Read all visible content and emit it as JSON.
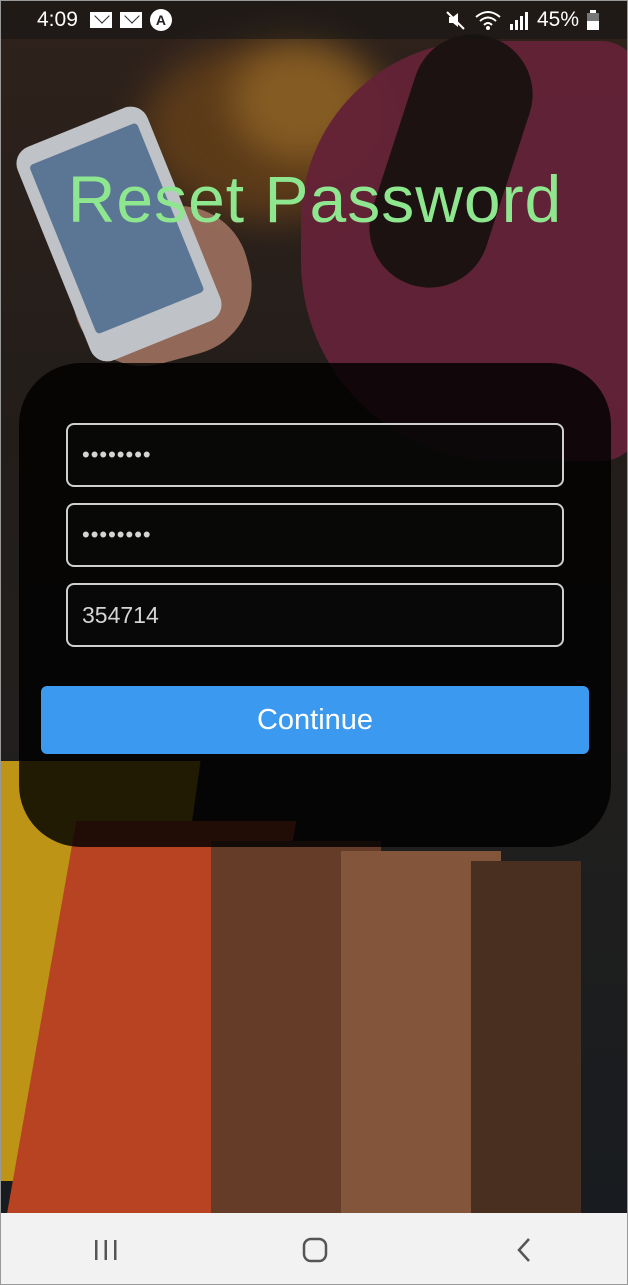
{
  "status_bar": {
    "time": "4:09",
    "battery": "45%",
    "icons": [
      "mail-icon",
      "mail-icon",
      "app-icon",
      "mute-icon",
      "wifi-icon",
      "signal-icon",
      "battery-icon"
    ],
    "app_icon_glyph": "A"
  },
  "page": {
    "title": "Reset Password",
    "title_color": "#8ee68f"
  },
  "form": {
    "password_value": "••••••••",
    "confirm_password_value": "••••••••",
    "code_value": "354714",
    "continue_label": "Continue",
    "button_color": "#3b99f0"
  },
  "nav_bar": {
    "icons": [
      "recents-icon",
      "home-icon",
      "back-icon"
    ]
  }
}
